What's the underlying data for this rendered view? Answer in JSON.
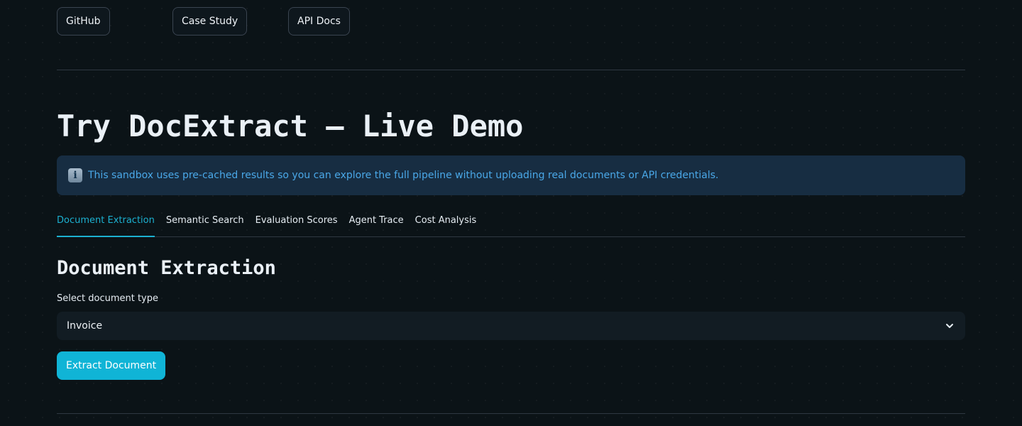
{
  "links": {
    "github": "GitHub",
    "case_study": "Case Study",
    "api_docs": "API Docs"
  },
  "title": "Try DocExtract — Live Demo",
  "info": {
    "icon": "info-icon",
    "text": "This sandbox uses pre-cached results so you can explore the full pipeline without uploading real documents or API credentials."
  },
  "tabs": [
    {
      "label": "Document Extraction",
      "active": true
    },
    {
      "label": "Semantic Search",
      "active": false
    },
    {
      "label": "Evaluation Scores",
      "active": false
    },
    {
      "label": "Agent Trace",
      "active": false
    },
    {
      "label": "Cost Analysis",
      "active": false
    }
  ],
  "section": {
    "heading": "Document Extraction",
    "select_label": "Select document type",
    "select_value": "Invoice",
    "button_label": "Extract Document"
  },
  "colors": {
    "background": "#0b1317",
    "accent": "#10b4d6",
    "info_bg": "#172d42",
    "info_text": "#4aa8e8"
  }
}
